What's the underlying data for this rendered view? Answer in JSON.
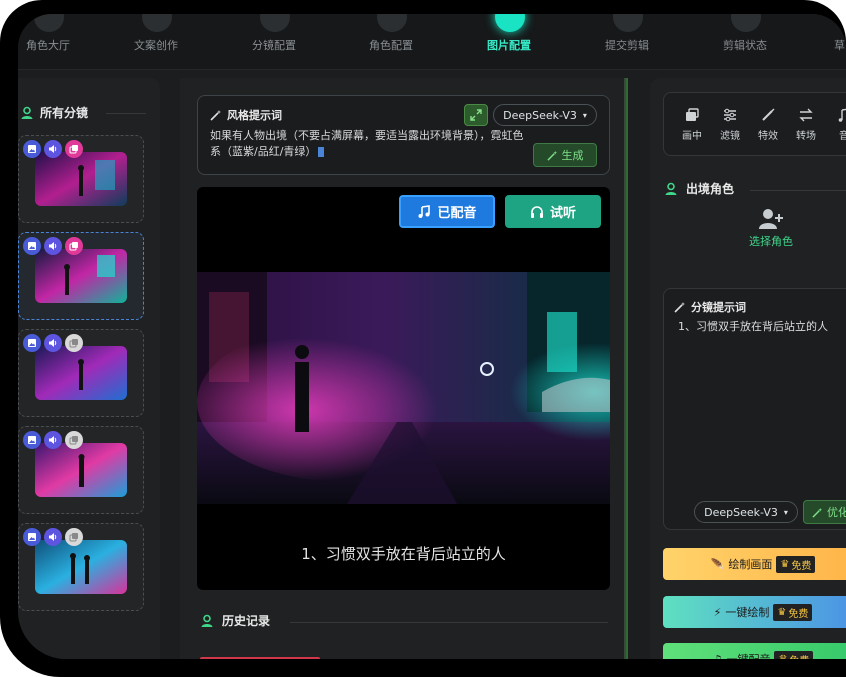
{
  "steps": [
    {
      "label": "角色大厅"
    },
    {
      "label": "文案创作"
    },
    {
      "label": "分镜配置"
    },
    {
      "label": "角色配置"
    },
    {
      "label": "图片配置"
    },
    {
      "label": "提交剪辑"
    },
    {
      "label": "剪辑状态"
    },
    {
      "label": "草"
    }
  ],
  "left": {
    "title": "所有分镜"
  },
  "style_prompt": {
    "title": "风格提示词",
    "model": "DeepSeek-V3",
    "text": "如果有人物出境（不要占满屏幕，要适当露出环境背景），霓虹色系（蓝紫/品红/青绿）",
    "generate_label": "生成"
  },
  "preview": {
    "dubbed_label": "已配音",
    "listen_label": "试听",
    "caption": "1、习惯双手放在背后站立的人"
  },
  "history": {
    "title": "历史记录"
  },
  "tools": [
    {
      "label": "画中",
      "icon": "pip-icon"
    },
    {
      "label": "滤镜",
      "icon": "filter-icon"
    },
    {
      "label": "特效",
      "icon": "effect-icon"
    },
    {
      "label": "转场",
      "icon": "transition-icon"
    },
    {
      "label": "音",
      "icon": "music-icon"
    }
  ],
  "role": {
    "title": "出境角色",
    "choose_label": "选择角色"
  },
  "shot_prompt": {
    "title": "分镜提示词",
    "text": "1、习惯双手放在背后站立的人",
    "model": "DeepSeek-V3",
    "optimize_label": "优化"
  },
  "actions": [
    {
      "label": "绘制画面",
      "free": "免费"
    },
    {
      "label": "一键绘制",
      "free": "免费"
    },
    {
      "label": "一键配音",
      "free": "免费"
    }
  ],
  "colors": {
    "accent_teal": "#19e3c2",
    "primary_blue": "#1f7ae0",
    "listen_green": "#1fa483"
  }
}
